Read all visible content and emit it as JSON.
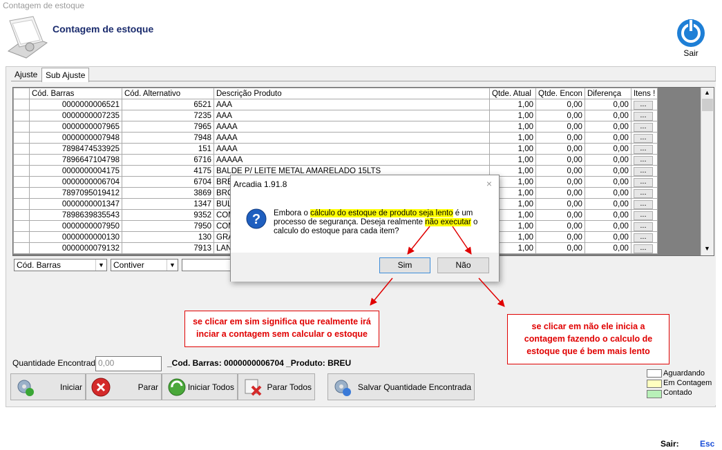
{
  "window": {
    "title": "Contagem de estoque"
  },
  "header": {
    "title": "Contagem de estoque",
    "exit_label": "Sair"
  },
  "tabs": [
    {
      "label": "Ajuste"
    },
    {
      "label": "Sub Ajuste"
    }
  ],
  "grid": {
    "columns": [
      "Cód. Barras",
      "Cód. Alternativo",
      "Descrição Produto",
      "Qtde. Atual",
      "Qtde. Encon",
      "Diferença",
      "Itens !"
    ],
    "button_label": "...",
    "rows": [
      [
        "0000000006521",
        "6521",
        "AAA",
        "1,00",
        "0,00",
        "0,00"
      ],
      [
        "0000000007235",
        "7235",
        "AAA",
        "1,00",
        "0,00",
        "0,00"
      ],
      [
        "0000000007965",
        "7965",
        "AAAA",
        "1,00",
        "0,00",
        "0,00"
      ],
      [
        "0000000007948",
        "7948",
        "AAAA",
        "1,00",
        "0,00",
        "0,00"
      ],
      [
        "7898474533925",
        "151",
        "AAAA",
        "1,00",
        "0,00",
        "0,00"
      ],
      [
        "7896647104798",
        "6716",
        "AAAAA",
        "1,00",
        "0,00",
        "0,00"
      ],
      [
        "0000000004175",
        "4175",
        "BALDE P/ LEITE METAL AMARELADO 15LTS",
        "1,00",
        "0,00",
        "0,00"
      ],
      [
        "0000000006704",
        "6704",
        "BRE",
        "1,00",
        "0,00",
        "0,00"
      ],
      [
        "7897095019412",
        "3869",
        "BRO",
        "1,00",
        "0,00",
        "0,00"
      ],
      [
        "0000000001347",
        "1347",
        "BUL",
        "1,00",
        "0,00",
        "0,00"
      ],
      [
        "7898639835543",
        "9352",
        "COM",
        "1,00",
        "0,00",
        "0,00"
      ],
      [
        "0000000007950",
        "7950",
        "COM",
        "1,00",
        "0,00",
        "0,00"
      ],
      [
        "0000000000130",
        "130",
        "GRA",
        "1,00",
        "0,00",
        "0,00"
      ],
      [
        "0000000079132",
        "7913",
        "LAN",
        "1,00",
        "0,00",
        "0,00"
      ]
    ]
  },
  "filters": {
    "field": "Cód. Barras",
    "operator": "Contiver",
    "value": ""
  },
  "quantity": {
    "label": "Quantidade Encontrada:",
    "placeholder": "0,00"
  },
  "info": {
    "text": "_Cod. Barras: 0000000006704 _Produto: BREU"
  },
  "buttons": {
    "iniciar": "Iniciar",
    "parar": "Parar",
    "iniciar_todos": "Iniciar Todos",
    "parar_todos": "Parar Todos",
    "salvar": "Salvar Quantidade Encontrada"
  },
  "legend": [
    {
      "label": "Aguardando",
      "color": "#ffffff"
    },
    {
      "label": "Em Contagem",
      "color": "#ffffc0"
    },
    {
      "label": "Contado",
      "color": "#b8f0b8"
    }
  ],
  "footer": {
    "label": "Sair:",
    "key": "Esc"
  },
  "dialog": {
    "title": "Arcadia 1.91.8",
    "close": "×",
    "msg": {
      "p1": "Embora o ",
      "h1": "cálculo do estoque de produto seja lento",
      "p2": " é um processo de segurança. Deseja realmente ",
      "h2": "não executar",
      "p3": " o calculo do estoque para cada item?"
    },
    "yes": "Sim",
    "no": "Não"
  },
  "notes": {
    "sim": "se clicar em sim significa que realmente irá inciar a contagem sem calcular o estoque",
    "nao": "se clicar em não ele inicia a contagem fazendo o calculo de estoque que é bem mais lento"
  },
  "colors": {
    "accent": "#1a2b6d",
    "annotation": "#e00000",
    "highlight": "#ffff00"
  }
}
